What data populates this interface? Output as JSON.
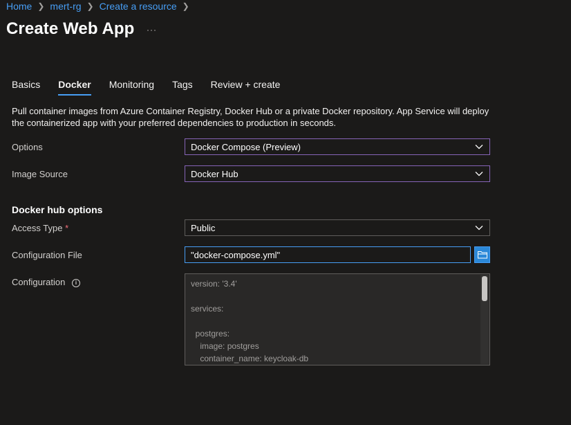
{
  "breadcrumb": [
    "Home",
    "mert-rg",
    "Create a resource"
  ],
  "title": "Create Web App",
  "more": "···",
  "tabs": [
    "Basics",
    "Docker",
    "Monitoring",
    "Tags",
    "Review + create"
  ],
  "active_tab": "Docker",
  "description": "Pull container images from Azure Container Registry, Docker Hub or a private Docker repository. App Service will deploy the containerized app with your preferred dependencies to production in seconds.",
  "options": {
    "label": "Options",
    "value": "Docker Compose (Preview)"
  },
  "image_source": {
    "label": "Image Source",
    "value": "Docker Hub"
  },
  "hub_section": "Docker hub options",
  "access_type": {
    "label": "Access Type",
    "required_mark": "*",
    "value": "Public"
  },
  "config_file": {
    "label": "Configuration File",
    "value": "\"docker-compose.yml\""
  },
  "configuration": {
    "label": "Configuration",
    "info": "i",
    "content": "version: '3.4'\n\nservices:\n\n  postgres:\n    image: postgres\n    container_name: keycloak-db"
  },
  "colors": {
    "accent": "#479ef5",
    "select_border": "#8764b8",
    "background": "#1b1a19"
  }
}
